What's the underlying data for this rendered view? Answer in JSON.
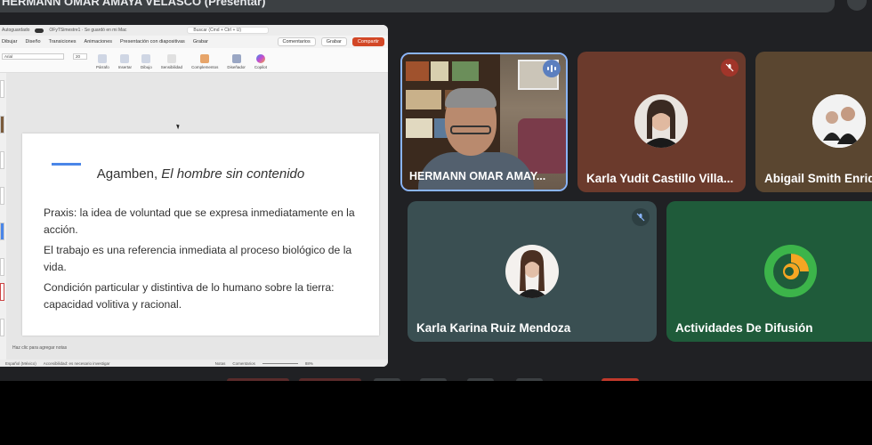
{
  "banner": {
    "text": "HERMANN OMAR AMAYA VELASCO (Presentar)"
  },
  "ppt": {
    "title_bar": {
      "autosave": "Autoguardado",
      "filename": "OFyTSimestre1 · Se guardó en mi Mac",
      "search": "Buscar (Cmd + Ctrl + U)"
    },
    "menu": [
      "Dibujar",
      "Diseño",
      "Transiciones",
      "Animaciones",
      "Presentación con diapositivas",
      "Grabar"
    ],
    "menu_right": {
      "comments": "Comentarios",
      "record": "Grabar",
      "share": "Compartir"
    },
    "ribbon": {
      "font": "Arial",
      "size": "20",
      "groups": [
        "Párrafo",
        "Insertar",
        "Dibujo",
        "Sensibilidad",
        "Complementos",
        "Diseñador",
        "Copilot"
      ]
    },
    "slide": {
      "title_plain": "Agamben, ",
      "title_italic": "El hombre sin contenido",
      "bullets": [
        "Praxis: la idea de voluntad que se expresa inmediatamente en la acción.",
        "El trabajo es una referencia inmediata al proceso biológico de la vida.",
        "Condición particular y distintiva de lo humano sobre la tierra: capacidad volitiva y racional."
      ]
    },
    "notes_hint": "Haz clic para agregar notas",
    "status": {
      "language": "Español (México)",
      "accessibility": "Accesibilidad: es necesario investigar",
      "notes": "Notas",
      "comments": "Comentarios",
      "zoom": "88%"
    }
  },
  "participants": [
    {
      "name": "HERMANN OMAR AMAY...",
      "speaking": true
    },
    {
      "name": "Karla Yudit Castillo Villa...",
      "muted": true
    },
    {
      "name": "Abigail Smith Enriquez"
    },
    {
      "name": "Karla Karina Ruiz Mendoza",
      "muted": true
    },
    {
      "name": "Actividades De Difusión"
    }
  ],
  "colors": {
    "tile_karla_yudit": "#6b3a2c",
    "tile_abigail": "#5a4630",
    "tile_karla_karina": "#3a4f52",
    "tile_actividades": "#1f5b3a",
    "share_button": "#d24726",
    "slide_accent": "#4a86e8"
  }
}
